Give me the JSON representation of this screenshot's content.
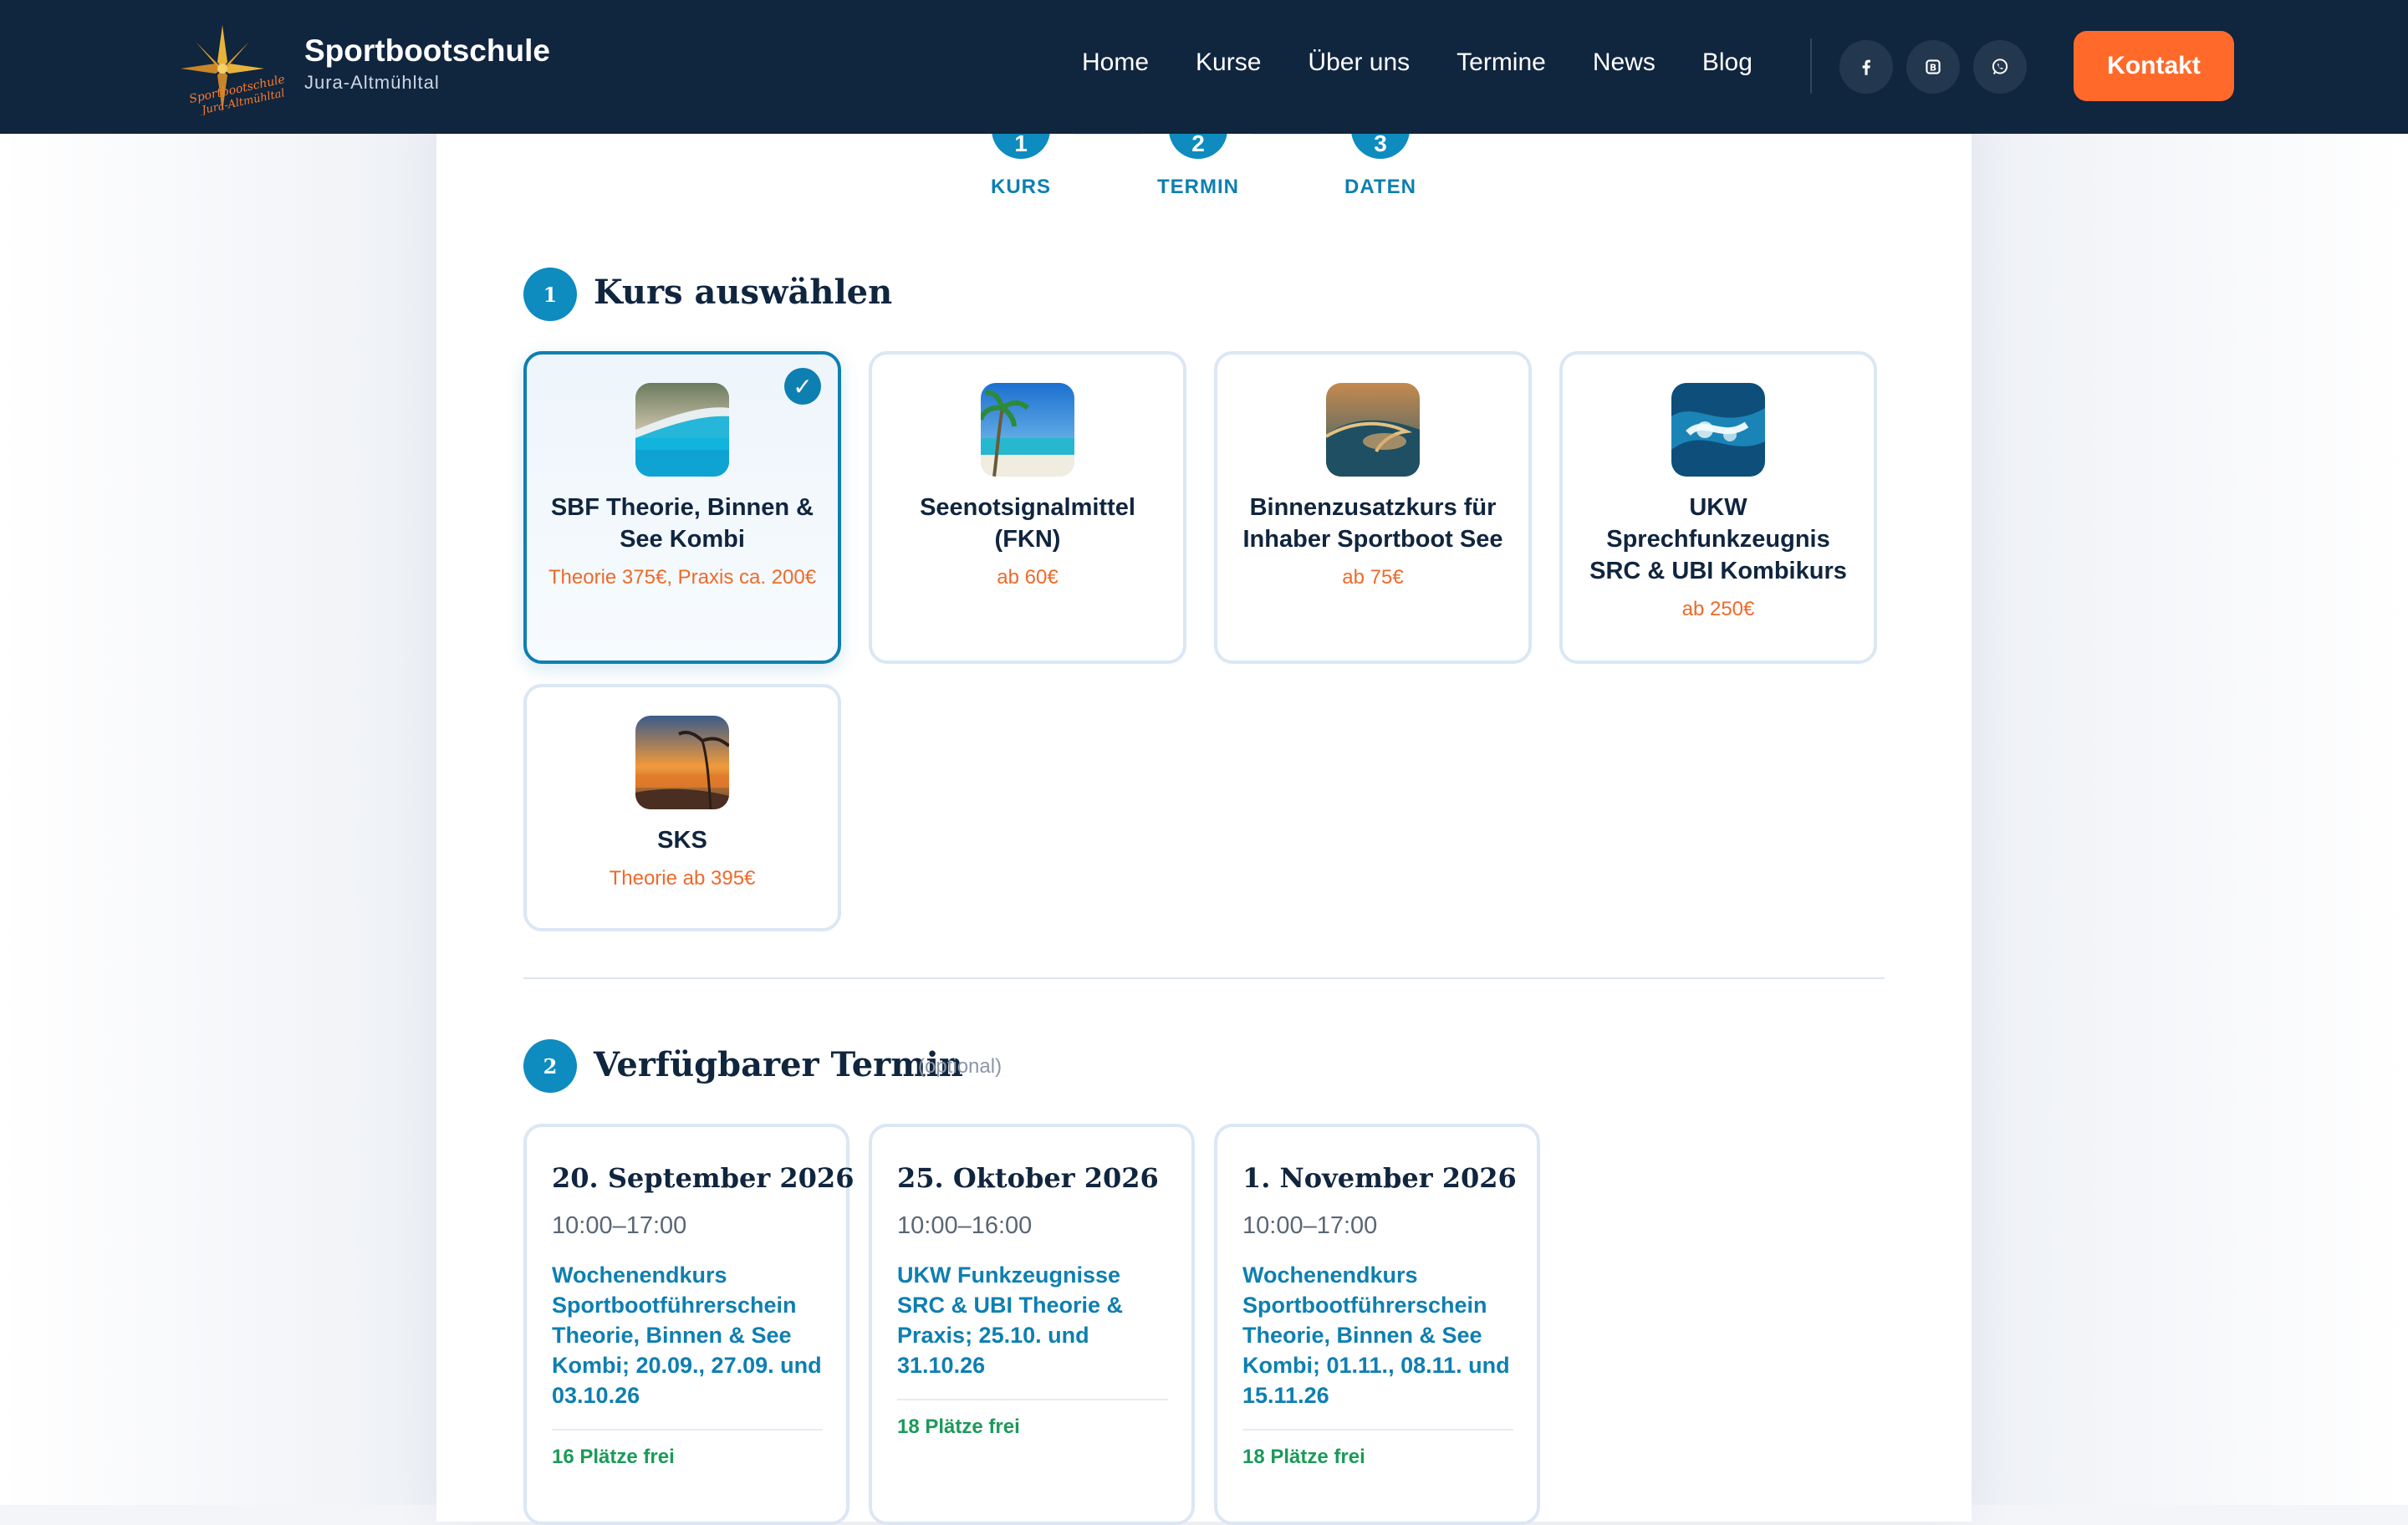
{
  "header": {
    "brand_title": "Sportbootschule",
    "brand_sub": "Jura-Altmühltal",
    "logo_text": "Sportbootschule Jura-Altmühltal",
    "nav": [
      "Home",
      "Kurse",
      "Über uns",
      "Termine",
      "News",
      "Blog"
    ],
    "social": [
      "facebook-icon",
      "booking-icon",
      "whatsapp-icon"
    ],
    "cta": "Kontakt"
  },
  "steps": [
    {
      "num": "1",
      "label": "KURS"
    },
    {
      "num": "2",
      "label": "TERMIN"
    },
    {
      "num": "3",
      "label": "DATEN"
    }
  ],
  "section1": {
    "num": "1",
    "title": "Kurs auswählen"
  },
  "courses": [
    {
      "title": "SBF Theorie, Binnen & See Kombi",
      "price": "Theorie 375€, Praxis ca. 200€",
      "selected": true,
      "check": "✓"
    },
    {
      "title": "Seenotsignalmittel (FKN)",
      "price": "ab 60€",
      "selected": false
    },
    {
      "title": "Binnenzusatzkurs für Inhaber Sportboot See",
      "price": "ab 75€",
      "selected": false
    },
    {
      "title": "UKW Sprechfunkzeugnis SRC & UBI Kombikurs",
      "price": "ab 250€",
      "selected": false
    },
    {
      "title": "SKS",
      "price": "Theorie ab 395€",
      "selected": false
    }
  ],
  "section2": {
    "num": "2",
    "title": "Verfügbarer Termin",
    "optional": "(optional)"
  },
  "dates": [
    {
      "title": "20. September 2026",
      "time": "10:00–17:00",
      "desc": "Wochenendkurs Sportbootführerschein Theorie, Binnen & See Kombi; 20.09., 27.09. und 03.10.26",
      "seats": "16 Plätze frei"
    },
    {
      "title": "25. Oktober 2026",
      "time": "10:00–16:00",
      "desc": "UKW Funkzeugnisse SRC & UBI Theorie & Praxis; 25.10. und 31.10.26",
      "seats": "18 Plätze frei"
    },
    {
      "title": "1. November 2026",
      "time": "10:00–17:00",
      "desc": "Wochenendkurs Sportbootführerschein Theorie, Binnen & See Kombi; 01.11., 08.11. und 15.11.26",
      "seats": "18 Plätze frei"
    }
  ],
  "colors": {
    "header_bg": "#10253e",
    "accent": "#0e8bbf",
    "cta": "#ff6a2b",
    "price": "#ee6a2a",
    "seats": "#1c9a5a"
  }
}
